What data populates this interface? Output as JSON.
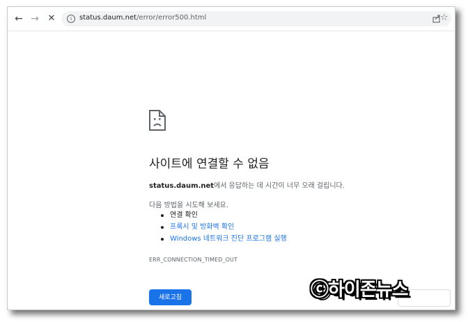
{
  "browser": {
    "back_icon": "←",
    "forward_icon": "→",
    "stop_icon": "✕",
    "info_icon": "i",
    "url_host": "status.daum.net",
    "url_path": "/error/error500.html",
    "bookmark_icon": "☆"
  },
  "error_page": {
    "title": "사이트에 연결할 수 없음",
    "host": "status.daum.net",
    "message": "에서 응답하는 데 시간이 너무 오래 걸립니다.",
    "try_label": "다음 방법을 시도해 보세요.",
    "suggestions": [
      "연결 확인",
      "프록시 및 방화벽 확인",
      "Windows 네트워크 진단 프로그램 실행"
    ],
    "error_code": "ERR_CONNECTION_TIMED_OUT",
    "reload_label": "새로고침"
  },
  "watermark": {
    "text": "ⓒ하이존뉴스"
  },
  "colors": {
    "accent": "#1a73e8",
    "text": "#202124",
    "secondary_text": "#5f6368"
  }
}
